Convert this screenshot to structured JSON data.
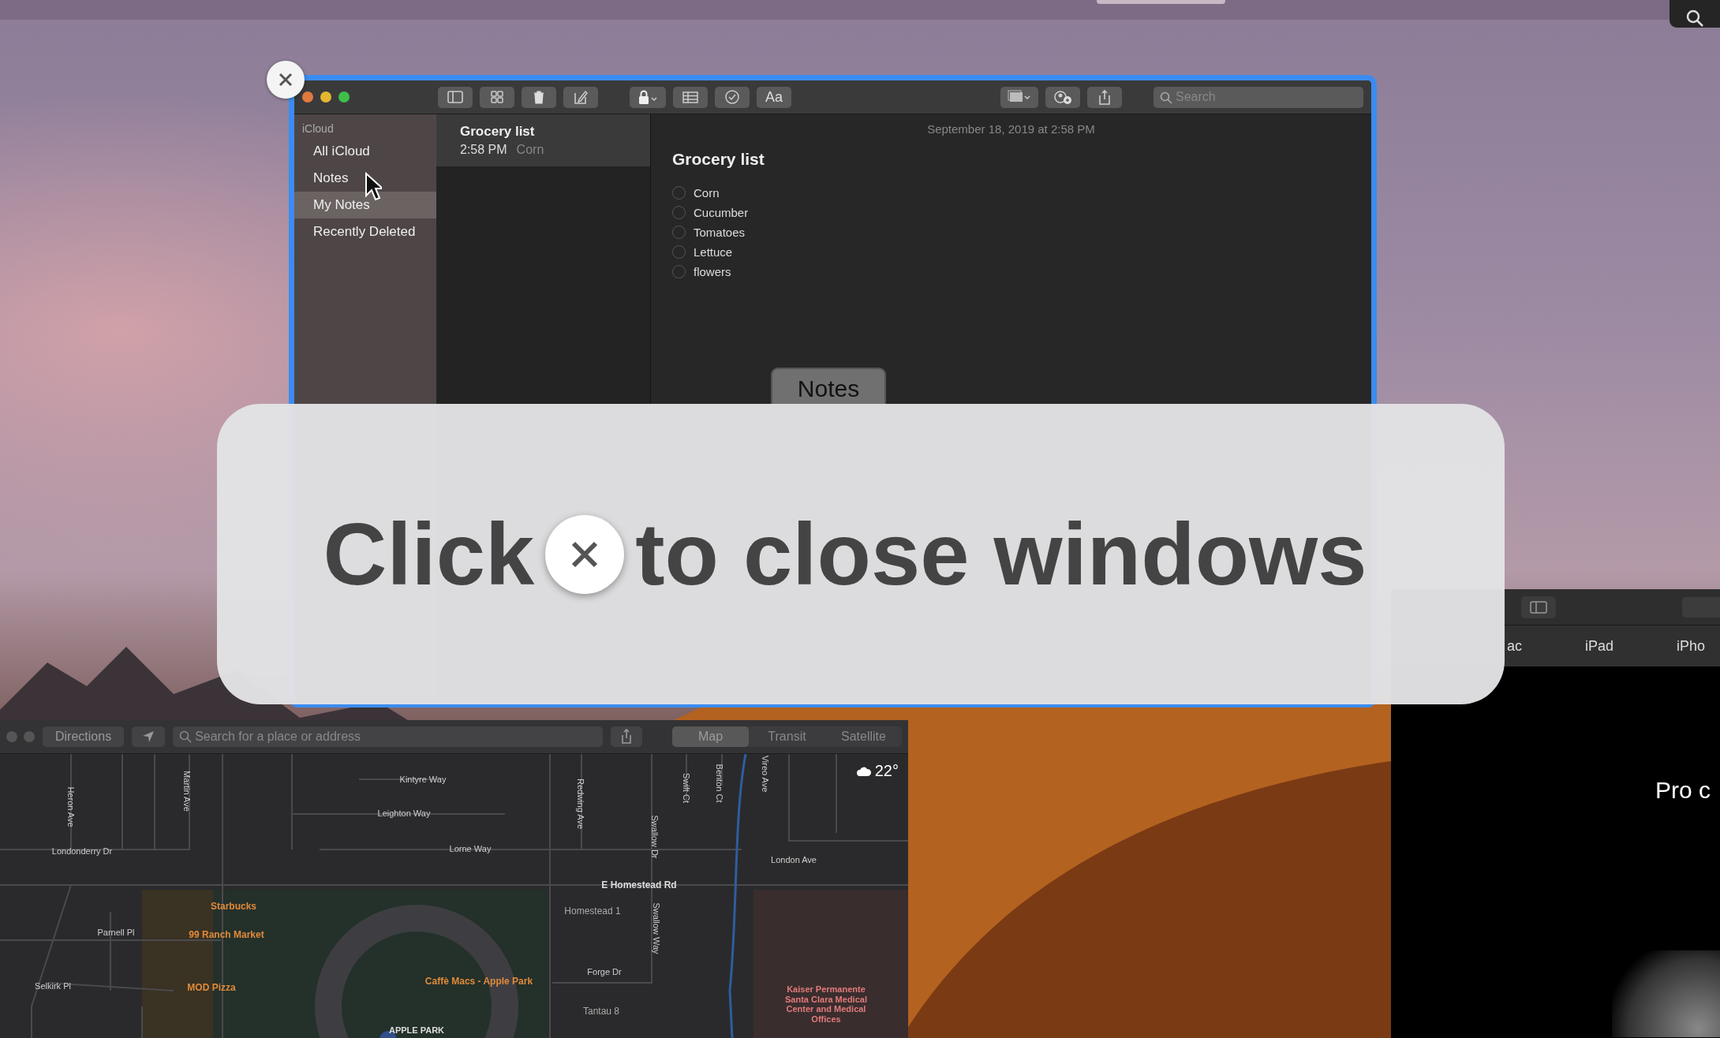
{
  "notes_window": {
    "search": {
      "placeholder": "Search"
    },
    "sidebar": {
      "header": "iCloud",
      "items": [
        {
          "label": "All iCloud",
          "selected": false
        },
        {
          "label": "Notes",
          "selected": false
        },
        {
          "label": "My Notes",
          "selected": true
        },
        {
          "label": "Recently Deleted",
          "selected": false
        }
      ]
    },
    "note_list": [
      {
        "title": "Grocery list",
        "time": "2:58 PM",
        "preview": "Corn",
        "selected": true
      }
    ],
    "editor": {
      "date": "September 18, 2019 at 2:58 PM",
      "title": "Grocery list",
      "checklist": [
        {
          "text": "Corn",
          "checked": false
        },
        {
          "text": "Cucumber",
          "checked": false
        },
        {
          "text": "Tomatoes",
          "checked": false
        },
        {
          "text": "Lettuce",
          "checked": false
        },
        {
          "text": "flowers",
          "checked": false
        }
      ]
    },
    "format_label": "Aa",
    "app_label": "Notes"
  },
  "overlay": {
    "before": "Click",
    "after": "to close windows"
  },
  "maps_window": {
    "directions": "Directions",
    "search": {
      "placeholder": "Search for a place or address"
    },
    "modes": [
      {
        "label": "Map",
        "selected": true
      },
      {
        "label": "Transit",
        "selected": false
      },
      {
        "label": "Satellite",
        "selected": false
      }
    ],
    "temperature": "22°",
    "labels": [
      {
        "text": "Kintyre Way",
        "kind": "street"
      },
      {
        "text": "Leighton Way",
        "kind": "street"
      },
      {
        "text": "Londonderry Dr",
        "kind": "street"
      },
      {
        "text": "Lorne Way",
        "kind": "street"
      },
      {
        "text": "E Homestead Rd",
        "kind": "major"
      },
      {
        "text": "London Ave",
        "kind": "street"
      },
      {
        "text": "Heron Ave",
        "kind": "vertical"
      },
      {
        "text": "Martin Ave",
        "kind": "vertical"
      },
      {
        "text": "Redwing Ave",
        "kind": "vertical"
      },
      {
        "text": "Swallow Dr",
        "kind": "vertical"
      },
      {
        "text": "Swift Ct",
        "kind": "vertical"
      },
      {
        "text": "Benton Ct",
        "kind": "vertical"
      },
      {
        "text": "Vireo Ave",
        "kind": "vertical"
      },
      {
        "text": "Homestead 1",
        "kind": "place"
      },
      {
        "text": "Swallow Way",
        "kind": "vertical"
      },
      {
        "text": "Parnell Pl",
        "kind": "street"
      },
      {
        "text": "Forge Dr",
        "kind": "street"
      },
      {
        "text": "Selkirk Pl",
        "kind": "street"
      },
      {
        "text": "Tantau 8",
        "kind": "place"
      },
      {
        "text": "Starbucks",
        "kind": "poi"
      },
      {
        "text": "99 Ranch Market",
        "kind": "poi"
      },
      {
        "text": "MOD Pizza",
        "kind": "poi"
      },
      {
        "text": "Caffè Macs - Apple Park",
        "kind": "poi"
      },
      {
        "text": "APPLE PARK",
        "kind": "landmark"
      },
      {
        "text": "Kaiser Permanente Santa Clara Medical Center and Medical Offices",
        "kind": "hospital"
      }
    ]
  },
  "safari_window": {
    "nav": [
      "ac",
      "iPad",
      "iPho"
    ],
    "headline": "Pro c"
  }
}
